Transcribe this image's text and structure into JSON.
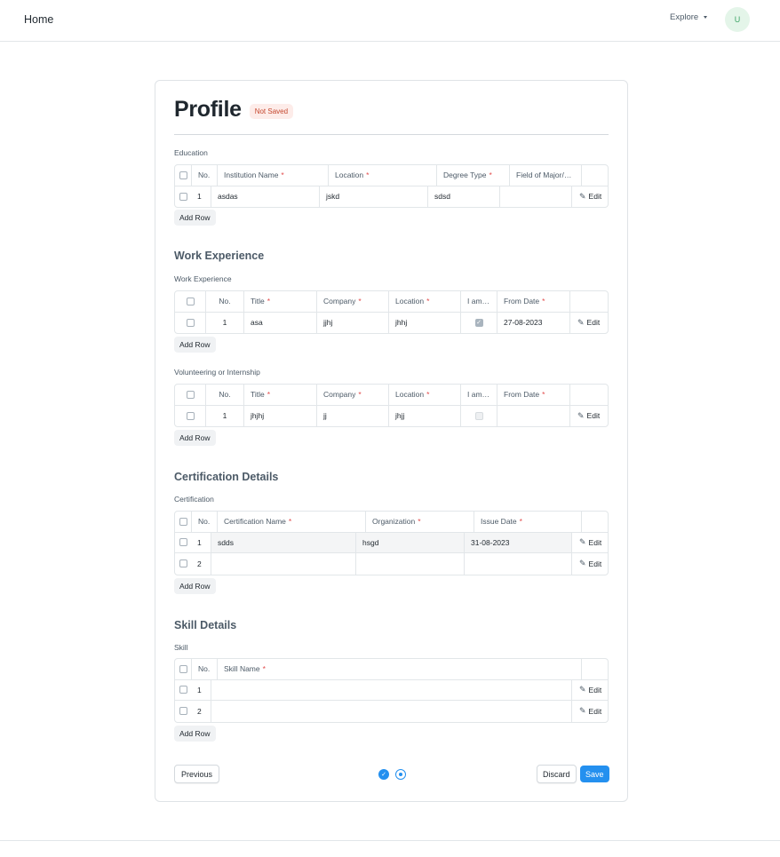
{
  "nav": {
    "home": "Home",
    "explore": "Explore",
    "avatar_initial": "U"
  },
  "page": {
    "title": "Profile",
    "status": "Not Saved"
  },
  "education": {
    "label": "Education",
    "headers": {
      "no": "No.",
      "institution": "Institution Name",
      "location": "Location",
      "degree": "Degree Type",
      "major": "Field of Major/…"
    },
    "rows": [
      {
        "no": "1",
        "institution": "asdas",
        "location": "jskd",
        "degree": "sdsd",
        "major": ""
      }
    ],
    "add_row": "Add Row"
  },
  "work": {
    "section_title": "Work Experience",
    "label": "Work Experience",
    "headers": {
      "no": "No.",
      "title": "Title",
      "company": "Company",
      "location": "Location",
      "current": "I am…",
      "from": "From Date"
    },
    "rows": [
      {
        "no": "1",
        "title": "asa",
        "company": "jjhj",
        "location": "jhhj",
        "current": true,
        "from": "27-08-2023"
      }
    ],
    "add_row": "Add Row"
  },
  "volunteering": {
    "label": "Volunteering or Internship",
    "headers": {
      "no": "No.",
      "title": "Title",
      "company": "Company",
      "location": "Location",
      "current": "I am…",
      "from": "From Date"
    },
    "rows": [
      {
        "no": "1",
        "title": "jhjhj",
        "company": "jj",
        "location": "jhjj",
        "current": false,
        "from": ""
      }
    ],
    "add_row": "Add Row"
  },
  "certification": {
    "section_title": "Certification Details",
    "label": "Certification",
    "headers": {
      "no": "No.",
      "name": "Certification Name",
      "org": "Organization",
      "issue": "Issue Date"
    },
    "rows": [
      {
        "no": "1",
        "name": "sdds",
        "org": "hsgd",
        "issue": "31-08-2023"
      },
      {
        "no": "2",
        "name": "",
        "org": "",
        "issue": ""
      }
    ],
    "add_row": "Add Row"
  },
  "skills": {
    "section_title": "Skill Details",
    "label": "Skill",
    "headers": {
      "no": "No.",
      "name": "Skill Name"
    },
    "rows": [
      {
        "no": "1",
        "name": ""
      },
      {
        "no": "2",
        "name": ""
      }
    ],
    "add_row": "Add Row"
  },
  "row_action": "Edit",
  "required_mark": "*",
  "footer": {
    "previous": "Previous",
    "discard": "Discard",
    "save": "Save"
  },
  "icons": {
    "edit": "pencil-icon",
    "check": "check-icon",
    "caret": "caret-down-icon"
  },
  "colors": {
    "primary": "#2490ef",
    "required": "#e24c4c",
    "badge_bg": "#fdece9",
    "badge_text": "#c5482f"
  }
}
